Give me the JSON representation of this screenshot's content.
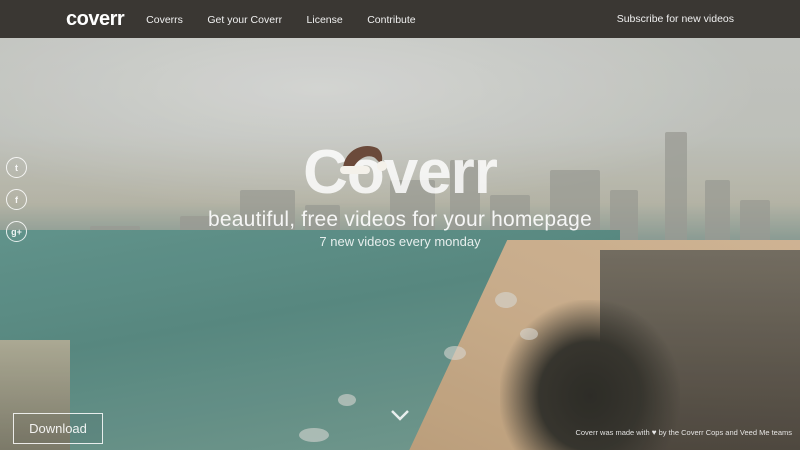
{
  "nav": {
    "logo": "coverr",
    "items": [
      "Coverrs",
      "Get your Coverr",
      "License",
      "Contribute"
    ],
    "subscribe": "Subscribe for new videos"
  },
  "social": {
    "icons": [
      "twitter-icon",
      "facebook-icon",
      "google-plus-icon"
    ],
    "glyphs": [
      "t",
      "f",
      "g+"
    ]
  },
  "hero": {
    "logo": "Coverr",
    "tagline": "beautiful, free videos for your homepage",
    "subtitle": "7 new videos every monday"
  },
  "actions": {
    "download": "Download"
  },
  "footer": {
    "note_before": "Coverr was made with",
    "note_after": "by the Coverr Cops and Veed Me teams"
  },
  "colors": {
    "topbar": "#3a3733",
    "hat_red": "#6b4a3a"
  }
}
